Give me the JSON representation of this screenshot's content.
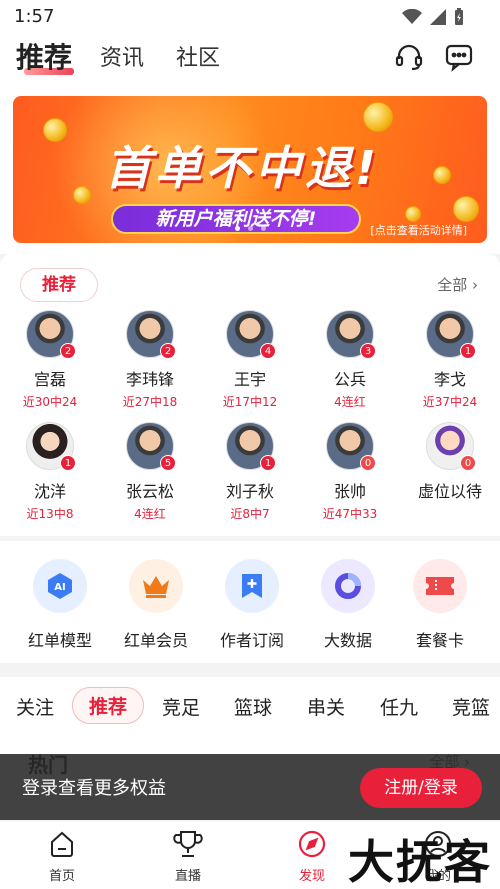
{
  "status": {
    "time": "1:57"
  },
  "header": {
    "tabs": [
      {
        "label": "推荐",
        "active": true
      },
      {
        "label": "资讯",
        "active": false
      },
      {
        "label": "社区",
        "active": false
      }
    ]
  },
  "banner": {
    "title": "首单不中退!",
    "subtitle": "新用户福利送不停!",
    "link": "[点击查看活动详情]",
    "slide_index": 0,
    "slide_count": 3
  },
  "experts": {
    "tag": "推荐",
    "all_label": "全部",
    "items": [
      {
        "name": "宫磊",
        "stat": "近30中24",
        "badge": "2"
      },
      {
        "name": "李玮锋",
        "stat": "近27中18",
        "badge": "2"
      },
      {
        "name": "王宇",
        "stat": "近17中12",
        "badge": "4"
      },
      {
        "name": "公兵",
        "stat": "4连红",
        "badge": "3"
      },
      {
        "name": "李戈",
        "stat": "近37中24",
        "badge": "1"
      },
      {
        "name": "沈洋",
        "stat": "近13中8",
        "badge": "1"
      },
      {
        "name": "张云松",
        "stat": "4连红",
        "badge": "5"
      },
      {
        "name": "刘子秋",
        "stat": "近8中7",
        "badge": "1"
      },
      {
        "name": "张帅",
        "stat": "近47中33",
        "badge": "0"
      },
      {
        "name": "虚位以待",
        "stat": "",
        "badge": "0"
      }
    ]
  },
  "tools": [
    {
      "label": "红单模型",
      "icon": "ai-icon",
      "color": "#3b7cf5"
    },
    {
      "label": "红单会员",
      "icon": "crown-icon",
      "color": "#f07a1a"
    },
    {
      "label": "作者订阅",
      "icon": "bookmark-plus-icon",
      "color": "#3b7cf5"
    },
    {
      "label": "大数据",
      "icon": "donut-chart-icon",
      "color": "#5b4de0"
    },
    {
      "label": "套餐卡",
      "icon": "ticket-icon",
      "color": "#ef4a4a"
    }
  ],
  "categories": [
    {
      "label": "关注",
      "active": false
    },
    {
      "label": "推荐",
      "active": true
    },
    {
      "label": "竞足",
      "active": false
    },
    {
      "label": "篮球",
      "active": false
    },
    {
      "label": "串关",
      "active": false
    },
    {
      "label": "任九",
      "active": false
    },
    {
      "label": "竞篮",
      "active": false
    }
  ],
  "hot": {
    "title": "热门",
    "all_label": "全部"
  },
  "login_bar": {
    "text": "登录查看更多权益",
    "button": "注册/登录"
  },
  "bottom_nav": [
    {
      "label": "首页",
      "icon": "home-icon",
      "active": false
    },
    {
      "label": "直播",
      "icon": "trophy-icon",
      "active": false
    },
    {
      "label": "发现",
      "icon": "compass-icon",
      "active": true
    },
    {
      "label": "我的",
      "icon": "user-icon",
      "active": false
    }
  ],
  "watermark": "大抚客",
  "colors": {
    "accent": "#e8203a"
  }
}
